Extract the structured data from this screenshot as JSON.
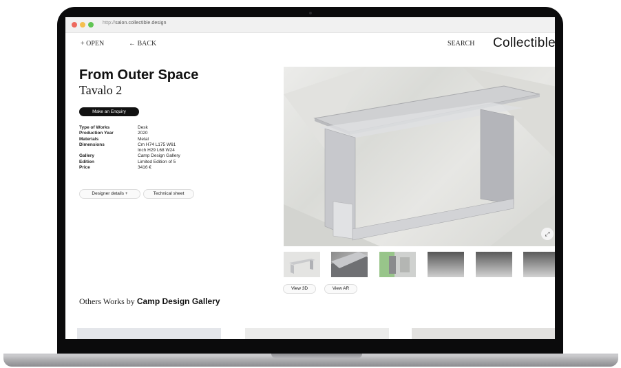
{
  "browser": {
    "url_prefix": "http://",
    "url_host": "salon.collectible.design"
  },
  "nav": {
    "open": "+ OPEN",
    "back": "← BACK",
    "search": "SEARCH",
    "logo": "Collectible"
  },
  "product": {
    "title": "From Outer Space",
    "subtitle": "Tavalo 2",
    "enquiry": "Make an Enquiry",
    "specs": [
      {
        "k": "Type of Works",
        "v": "Desk"
      },
      {
        "k": "Production Year",
        "v": "2020"
      },
      {
        "k": "Materials",
        "v": "Metal"
      },
      {
        "k": "Dimensions",
        "v": "Cm  H74  L175  W61"
      },
      {
        "k": "",
        "v": "Inch H29  L68   W24"
      },
      {
        "k": "Gallery",
        "v": "Camp Design Gallery"
      },
      {
        "k": "Edition",
        "v": "Limited Edition of 5"
      },
      {
        "k": "Price",
        "v": "3416 €"
      }
    ],
    "designer_details": "Designer details +",
    "technical_sheet": "Technical sheet"
  },
  "gallery": {
    "view3d": "View 3D",
    "viewar": "View AR",
    "expand_icon": "expand-icon"
  },
  "others": {
    "prefix": "Others Works by ",
    "gallery_name": "Camp Design Gallery"
  }
}
